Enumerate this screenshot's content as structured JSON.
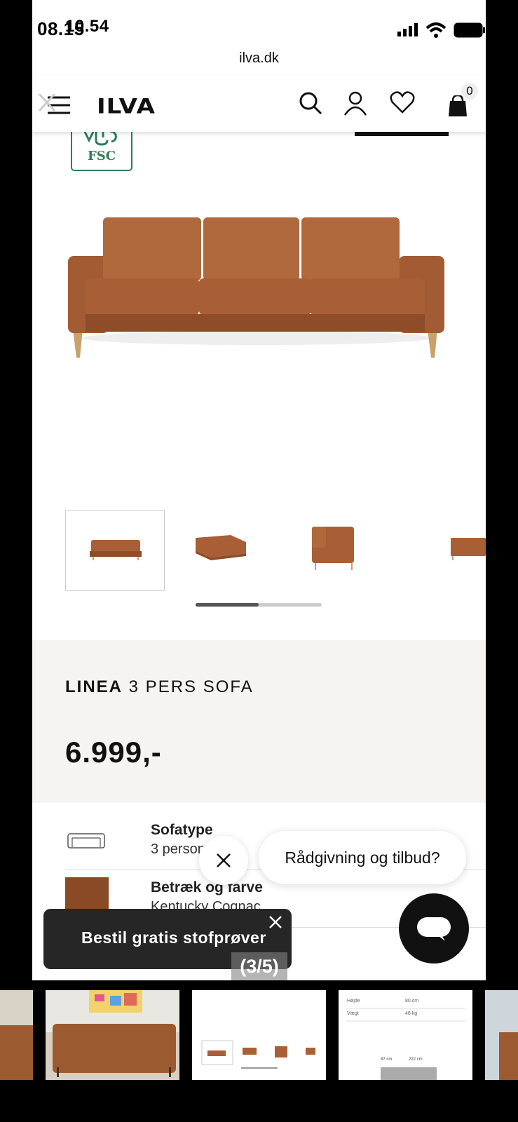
{
  "status_bar": {
    "time": "08.15",
    "time_overlay": "10.54"
  },
  "browser": {
    "url": "ilva.dk"
  },
  "nav": {
    "logo": "ILVA",
    "cart_count": "0"
  },
  "certification": {
    "label": "FSC"
  },
  "product": {
    "name_bold": "LINEA",
    "name_rest": " 3 PERS SOFA",
    "price": "6.999,-"
  },
  "gallery": {
    "thumbnail_count": 4,
    "active_index": 0,
    "scroll_progress": 0.5
  },
  "specs": [
    {
      "label": "Sofatype",
      "value": "3 personer"
    },
    {
      "label": "Betræk og farve",
      "value": "Kentucky Cognac"
    }
  ],
  "chat": {
    "advice_label": "Rådgivning og tilbud?"
  },
  "sample_banner": {
    "label": "Bestil gratis stofprøver"
  },
  "photo_counter": "(3/5)",
  "strip_dims": {
    "height_label": "Højde",
    "height_value": "80 cm",
    "weight_label": "Vægt",
    "weight_value": "48 kg",
    "dim_a": "87 cm",
    "dim_b": "222 cm"
  },
  "colors": {
    "leather": "#a8613a",
    "brand_green": "#2e7d5b",
    "dark": "#111111"
  }
}
